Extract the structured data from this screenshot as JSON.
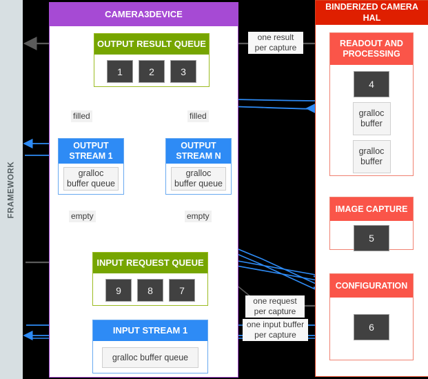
{
  "framework": {
    "label": "FRAMEWORK"
  },
  "camera3device": {
    "title": "CAMERA3DEVICE",
    "output_result_queue": {
      "title": "OUTPUT RESULT QUEUE",
      "chips": [
        "1",
        "2",
        "3"
      ]
    },
    "output_stream_1": {
      "title": "OUTPUT\nSTREAM 1",
      "title_line1": "OUTPUT",
      "title_line2": "STREAM 1",
      "gralloc": "gralloc\nbuffer queue",
      "gralloc_line1": "gralloc",
      "gralloc_line2": "buffer queue",
      "filled_label": "filled",
      "empty_label": "empty"
    },
    "output_stream_n": {
      "title_line1": "OUTPUT",
      "title_line2": "STREAM N",
      "gralloc_line1": "gralloc",
      "gralloc_line2": "buffer queue",
      "filled_label": "filled",
      "empty_label": "empty"
    },
    "ellipsis": "• • •",
    "input_request_queue": {
      "title": "INPUT REQUEST QUEUE",
      "chips": [
        "9",
        "8",
        "7"
      ]
    },
    "input_stream_1": {
      "title": "INPUT STREAM 1",
      "gralloc": "gralloc buffer queue"
    }
  },
  "hal": {
    "title_line1": "BINDERIZED CAMERA",
    "title_line2": "HAL",
    "readout": {
      "title_line1": "READOUT AND",
      "title_line2": "PROCESSING",
      "chip": "4",
      "buffers": [
        "gralloc\nbuffer",
        "gralloc\nbuffer"
      ],
      "buffer_line1": "gralloc",
      "buffer_line2": "buffer"
    },
    "image_capture": {
      "title": "IMAGE CAPTURE",
      "chip": "5"
    },
    "configuration": {
      "title": "CONFIGURATION",
      "chip": "6"
    }
  },
  "annotations": {
    "one_result_per_capture_l1": "one result",
    "one_result_per_capture_l2": "per capture",
    "one_request_per_capture_l1": "one request",
    "one_request_per_capture_l2": "per capture",
    "one_input_buffer_per_capture_l1": "one input buffer",
    "one_input_buffer_per_capture_l2": "per capture"
  },
  "colors": {
    "background": "#000000",
    "framework_bar": "#d7dfe2",
    "camera3device_header": "#a64ad4",
    "hal_header": "#df1f00",
    "queue_header": "#76a500",
    "stream_header": "#2e8bf5",
    "halblock_header": "#fa5549",
    "chip": "#414141",
    "arrow_grey": "#5b5b5b",
    "arrow_blue": "#2e8bf5"
  }
}
